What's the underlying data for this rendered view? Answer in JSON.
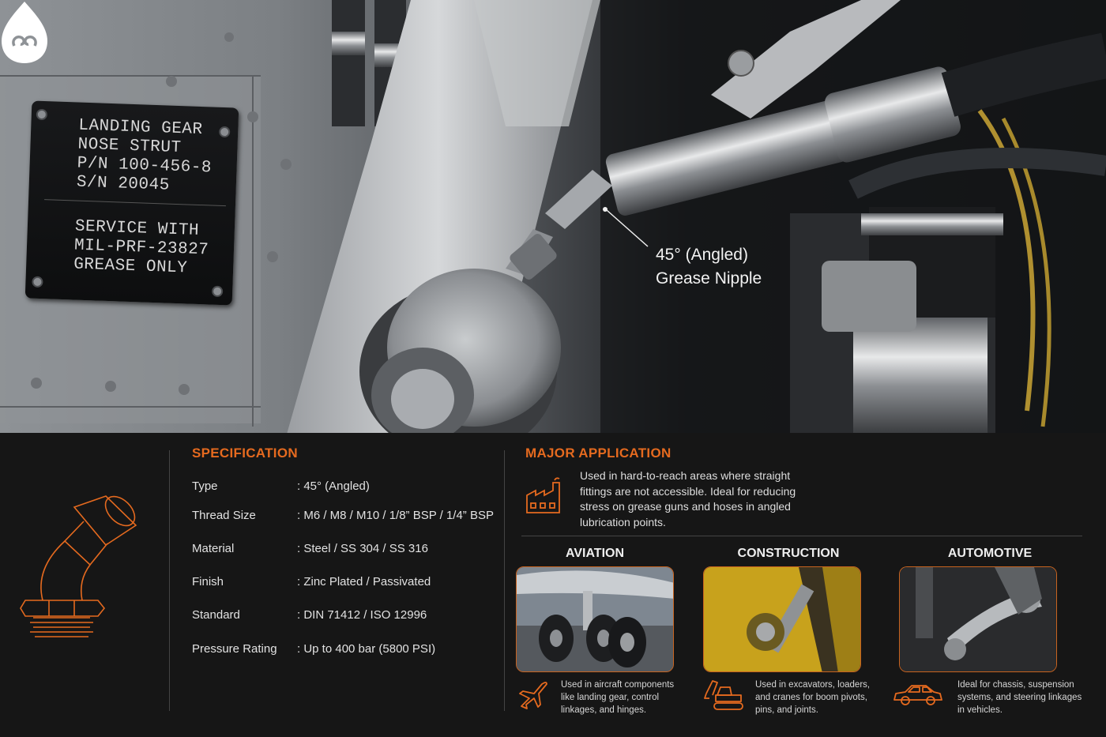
{
  "hero": {
    "plate_lines": [
      "LANDING GEAR",
      "NOSE STRUT",
      "P/N 100-456-8",
      "S/N 20045",
      "SERVICE WITH",
      "MIL-PRF-23827",
      "GREASE ONLY"
    ],
    "callout_line1": "45° (Angled)",
    "callout_line2": "Grease Nipple"
  },
  "specification": {
    "title": "SPECIFICATION",
    "rows": [
      {
        "label": "Type",
        "value": ": 45° (Angled)"
      },
      {
        "label": "Thread Size",
        "value": ": M6 / M8 / M10 / 1/8” BSP / 1/4” BSP"
      },
      {
        "label": "Material",
        "value": ": Steel / SS 304 / SS 316"
      },
      {
        "label": "Finish",
        "value": ": Zinc Plated / Passivated"
      },
      {
        "label": "Standard",
        "value": ": DIN 71412 / ISO 12996"
      },
      {
        "label": "Pressure Rating",
        "value": ": Up to 400 bar (5800 PSI)"
      }
    ]
  },
  "application": {
    "title": "MAJOR APPLICATION",
    "description": "Used in hard-to-reach areas where straight fittings are not accessible. Ideal for reducing stress on grease guns and hoses in angled lubrication points.",
    "cards": [
      {
        "title": "AVIATION",
        "desc": "Used in aircraft components like landing gear, control linkages, and hinges."
      },
      {
        "title": "CONSTRUCTION",
        "desc": "Used in excavators, loaders, and cranes for boom pivots, pins, and joints."
      },
      {
        "title": "AUTOMOTIVE",
        "desc": "Ideal for chassis, suspension systems, and steering linkages in vehicles."
      }
    ]
  },
  "colors": {
    "accent": "#e56a1f",
    "panel_bg": "#161616"
  },
  "icons": [
    "brand-logo-icon",
    "grease-nipple-outline-icon",
    "factory-icon",
    "airplane-icon",
    "excavator-icon",
    "car-icon"
  ]
}
